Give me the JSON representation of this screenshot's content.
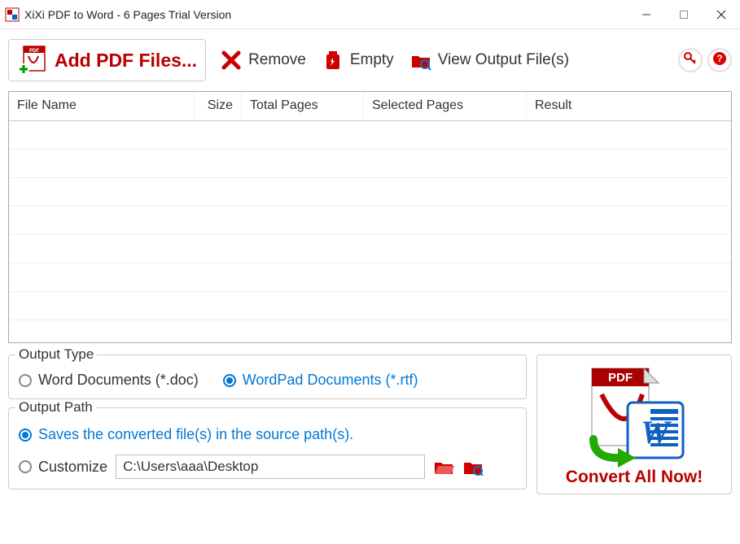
{
  "title": "XiXi PDF to Word - 6 Pages Trial Version",
  "toolbar": {
    "add_label": "Add PDF Files...",
    "remove_label": "Remove",
    "empty_label": "Empty",
    "view_output_label": "View Output File(s)"
  },
  "table": {
    "columns": [
      "File Name",
      "Size",
      "Total Pages",
      "Selected Pages",
      "Result"
    ],
    "rows": []
  },
  "output_type": {
    "title": "Output Type",
    "options": [
      {
        "label": "Word Documents (*.doc)",
        "selected": false
      },
      {
        "label": "WordPad Documents (*.rtf)",
        "selected": true
      }
    ]
  },
  "output_path": {
    "title": "Output Path",
    "option_source": {
      "label": "Saves the converted file(s) in the source path(s).",
      "selected": true
    },
    "option_custom": {
      "label": "Customize",
      "selected": false
    },
    "custom_value": "C:\\Users\\aaa\\Desktop"
  },
  "convert_label": "Convert All Now!"
}
